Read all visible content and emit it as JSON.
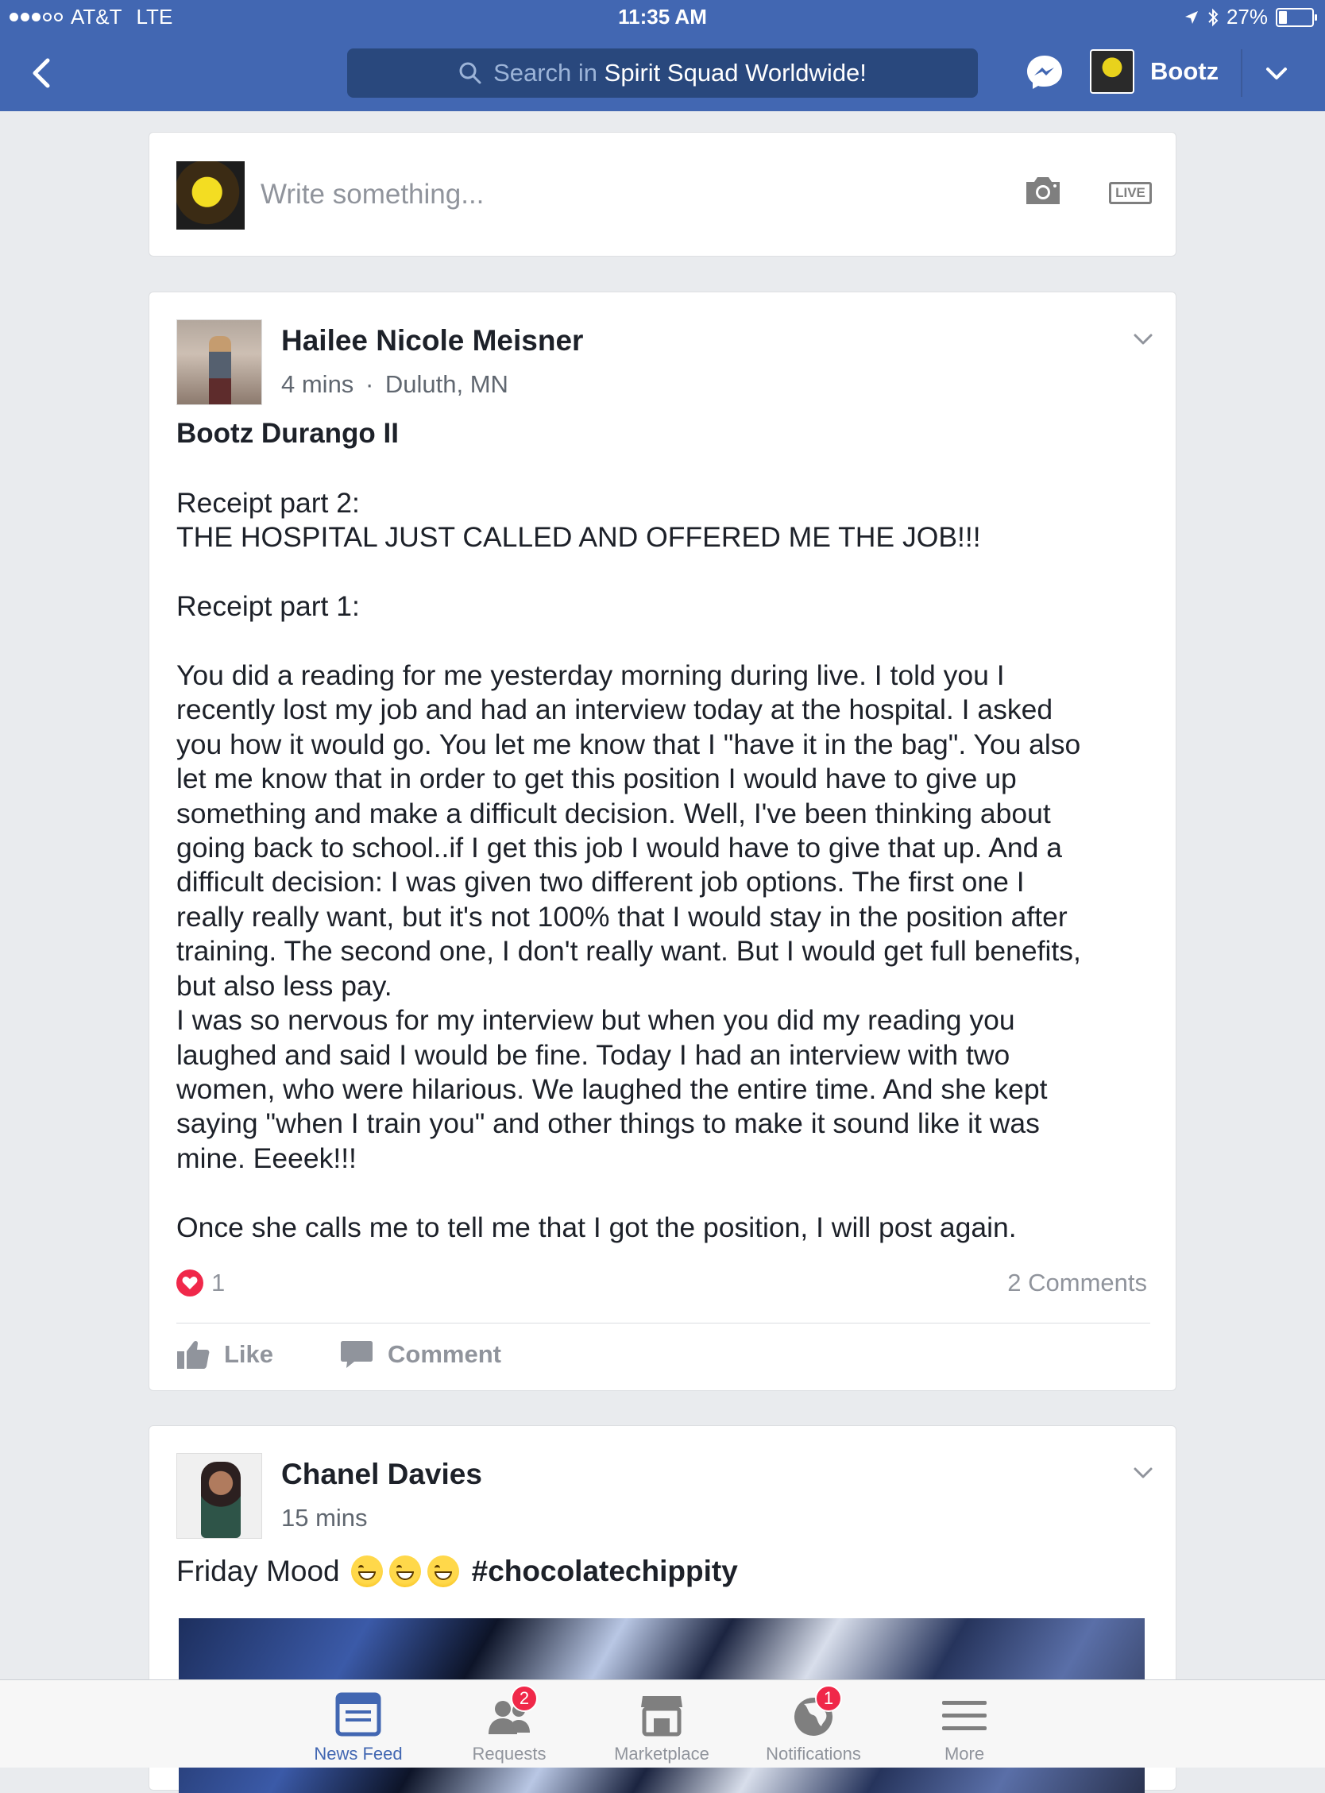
{
  "status_bar": {
    "carrier": "AT&T",
    "network": "LTE",
    "time": "11:35 AM",
    "battery_percent": "27%",
    "battery_level": 0.27,
    "signal_bars_filled": 3,
    "signal_bars_total": 5
  },
  "nav": {
    "search_prefix": "Search in",
    "search_group": "Spirit Squad Worldwide!",
    "user_name": "Bootz"
  },
  "composer": {
    "placeholder": "Write something...",
    "live_label": "LIVE"
  },
  "posts": [
    {
      "author": "Hailee Nicole Meisner",
      "time": "4 mins",
      "separator": "·",
      "location": "Duluth, MN",
      "target": "Bootz Durango II",
      "body": "Receipt part 2:\nTHE HOSPITAL JUST CALLED AND OFFERED ME THE JOB!!!\n\nReceipt part 1:\n\nYou did a reading for me yesterday morning during live. I told you I\nrecently lost my job and had an interview today at the hospital. I asked\nyou how it would go. You let me know that I \"have it in the bag\". You also\nlet me know that in order to get this position I would have to give up\nsomething and make a difficult decision. Well, I've been thinking about\ngoing back to school..if I get this job I would have to give that up. And a\ndifficult decision: I was given two different job options. The first one I\nreally really want, but it's not 100% that I would stay in the position after\ntraining. The second one, I don't really want. But I would get full benefits,\nbut also less pay.\nI was so nervous for my interview but when you did my reading you\nlaughed and said I would be fine. Today I had an interview with two\nwomen, who were hilarious. We laughed the entire time. And she kept\nsaying \"when I train you\" and other things to make it sound like it was\nmine. Eeeek!!!\n\nOnce she calls me to tell me that I got the position, I will post again.",
      "reaction_count": "1",
      "comments": "2 Comments",
      "like_label": "Like",
      "comment_label": "Comment"
    },
    {
      "author": "Chanel Davies",
      "time": "15 mins",
      "text": "Friday Mood",
      "hashtag": "#chocolatechippity"
    }
  ],
  "tabs": [
    {
      "label": "News Feed",
      "icon": "news-feed-icon",
      "active": true
    },
    {
      "label": "Requests",
      "icon": "friend-requests-icon",
      "badge": "2"
    },
    {
      "label": "Marketplace",
      "icon": "marketplace-icon"
    },
    {
      "label": "Notifications",
      "icon": "globe-icon",
      "badge": "1"
    },
    {
      "label": "More",
      "icon": "menu-icon"
    }
  ],
  "colors": {
    "brand": "#4267b2",
    "search_bg": "#29487d",
    "badge": "#f02849",
    "heart": "#f0284a"
  }
}
